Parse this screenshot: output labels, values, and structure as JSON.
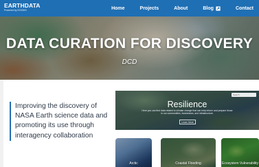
{
  "nav": {
    "logo_main": "EARTHDATA",
    "logo_sub": "Powered by EOSDIS",
    "links": [
      "Home",
      "Projects",
      "About",
      "Blog",
      "Contact"
    ],
    "blog_icon": "external-link-icon"
  },
  "hero": {
    "title": "DATA CURATION FOR DISCOVERY",
    "subtitle": "DCD"
  },
  "mission": {
    "text": "Improving the discovery of NASA Earth science data and promoting its use through interagency collaboration"
  },
  "feature": {
    "title": "Resilience",
    "body": "Here you can find data related to climate change that can help inform and prepare those in our communities, businesses, and infrastructure.",
    "button": "Learn More",
    "search_placeholder": "Search"
  },
  "cards": [
    {
      "label": "Arctic"
    },
    {
      "label": "Coastal Flooding"
    },
    {
      "label": "Ecosystem Vulnerability"
    }
  ],
  "colors": {
    "nav_bg": "#1f6fb4",
    "accent": "#1f6fb4",
    "mission_text": "#2f3a4a"
  }
}
